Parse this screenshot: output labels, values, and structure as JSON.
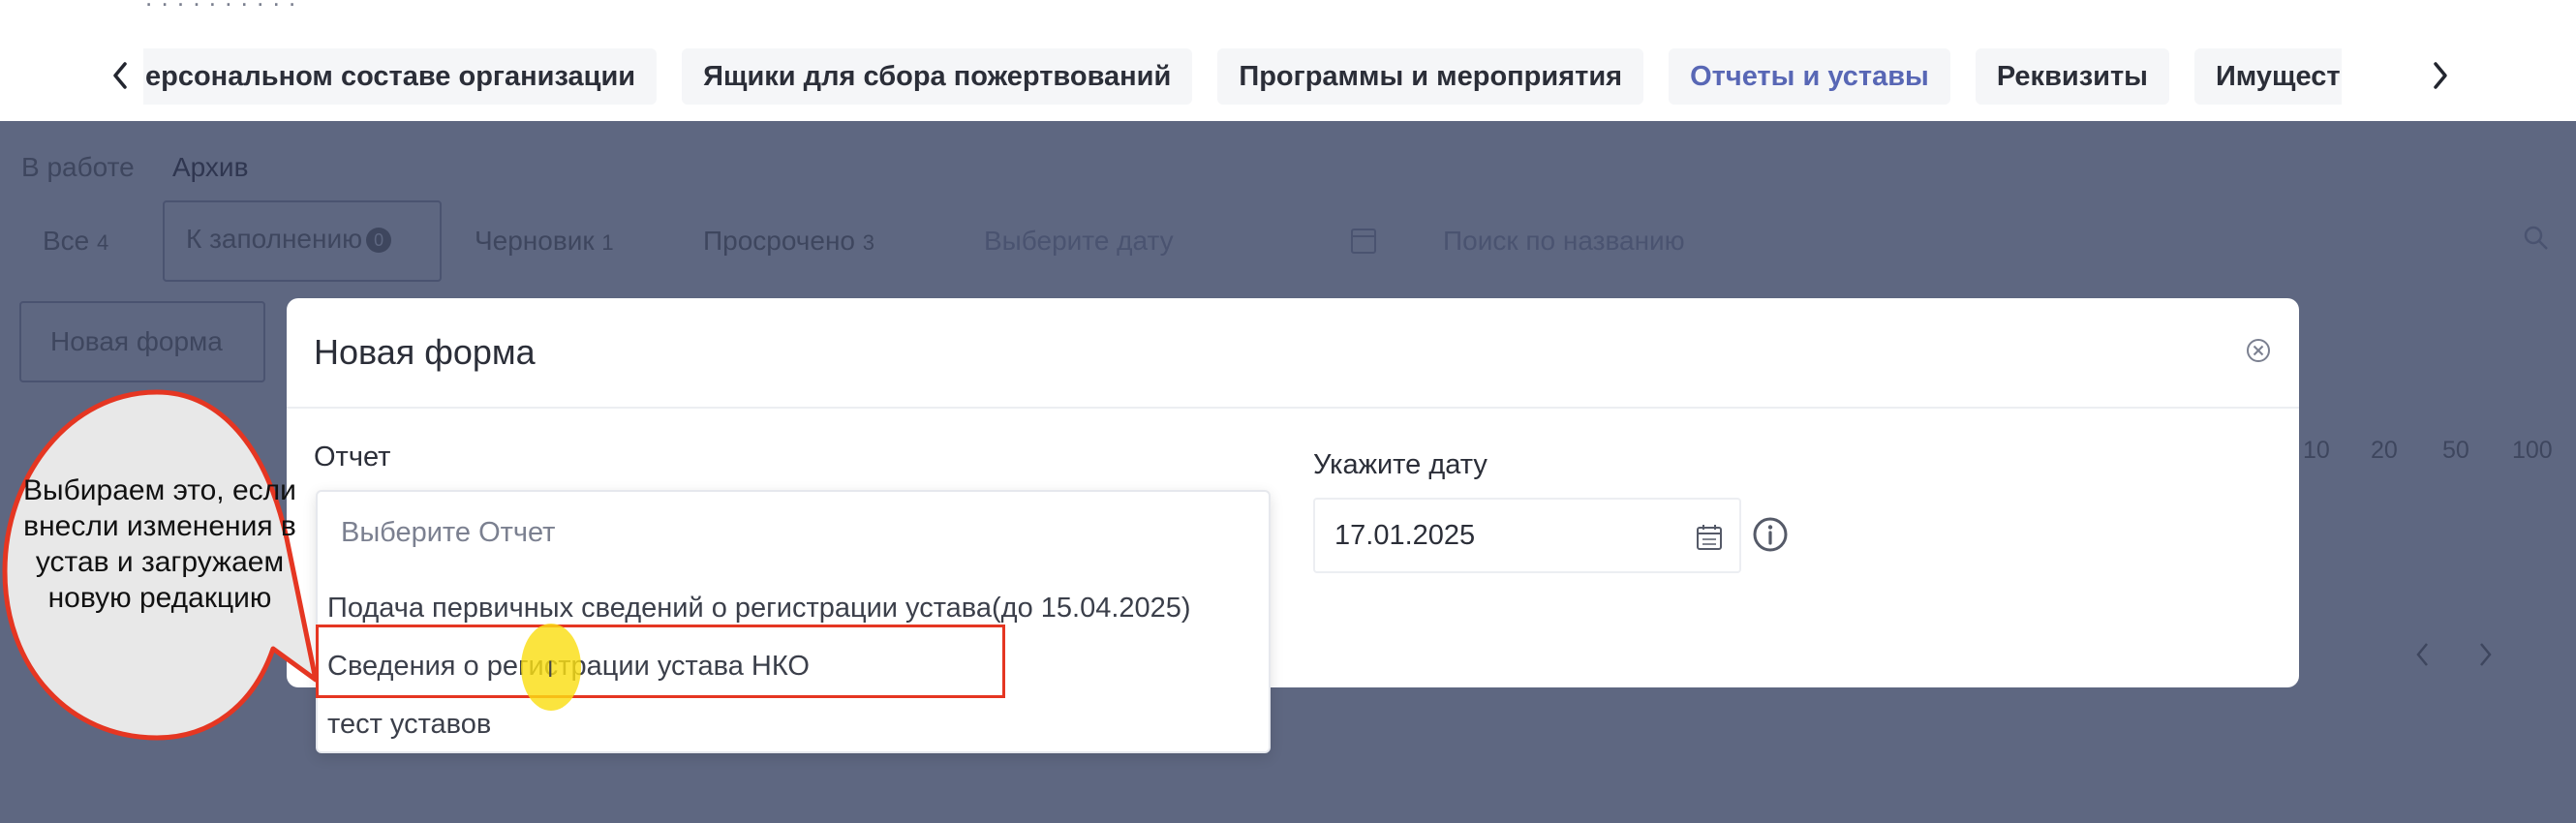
{
  "nav": {
    "tabs": [
      {
        "label": "ерсональном составе организации",
        "active": false
      },
      {
        "label": "Ящики для сбора пожертвований",
        "active": false
      },
      {
        "label": "Программы и мероприятия",
        "active": false
      },
      {
        "label": "Отчеты и уставы",
        "active": true
      },
      {
        "label": "Реквизиты",
        "active": false
      },
      {
        "label": "Имущество",
        "active": false
      }
    ]
  },
  "background": {
    "status_tabs": {
      "in_work": "В работе",
      "archive": "Архив"
    },
    "filters": {
      "all": "Все",
      "all_count": "4",
      "to_fill": "К заполнению",
      "to_fill_badge": "0",
      "draft": "Черновик",
      "draft_count": "1",
      "overdue": "Просрочено",
      "overdue_count": "3",
      "date_placeholder": "Выберите дату",
      "search_placeholder": "Поиск по названию"
    },
    "new_form_button": "Новая форма",
    "page_sizes": [
      "10",
      "20",
      "50",
      "100"
    ]
  },
  "modal": {
    "title": "Новая форма",
    "report_label": "Отчет",
    "report_placeholder": "Выберите Отчет",
    "date_label": "Укажите дату",
    "date_value": "17.01.2025",
    "options": [
      "Подача первичных сведений о регистрации устава(до 15.04.2025)",
      "Сведения о регистрации устава НКО",
      "тест уставов"
    ]
  },
  "annotation": {
    "callout_text": "Выбираем это, если внесли изменения в устав и загружаем новую редакцию",
    "highlighted_option_index": 1
  },
  "colors": {
    "accent": "#5867b5",
    "overlay": "#5e6781",
    "highlight": "#e53622",
    "cursor": "#fade14"
  }
}
